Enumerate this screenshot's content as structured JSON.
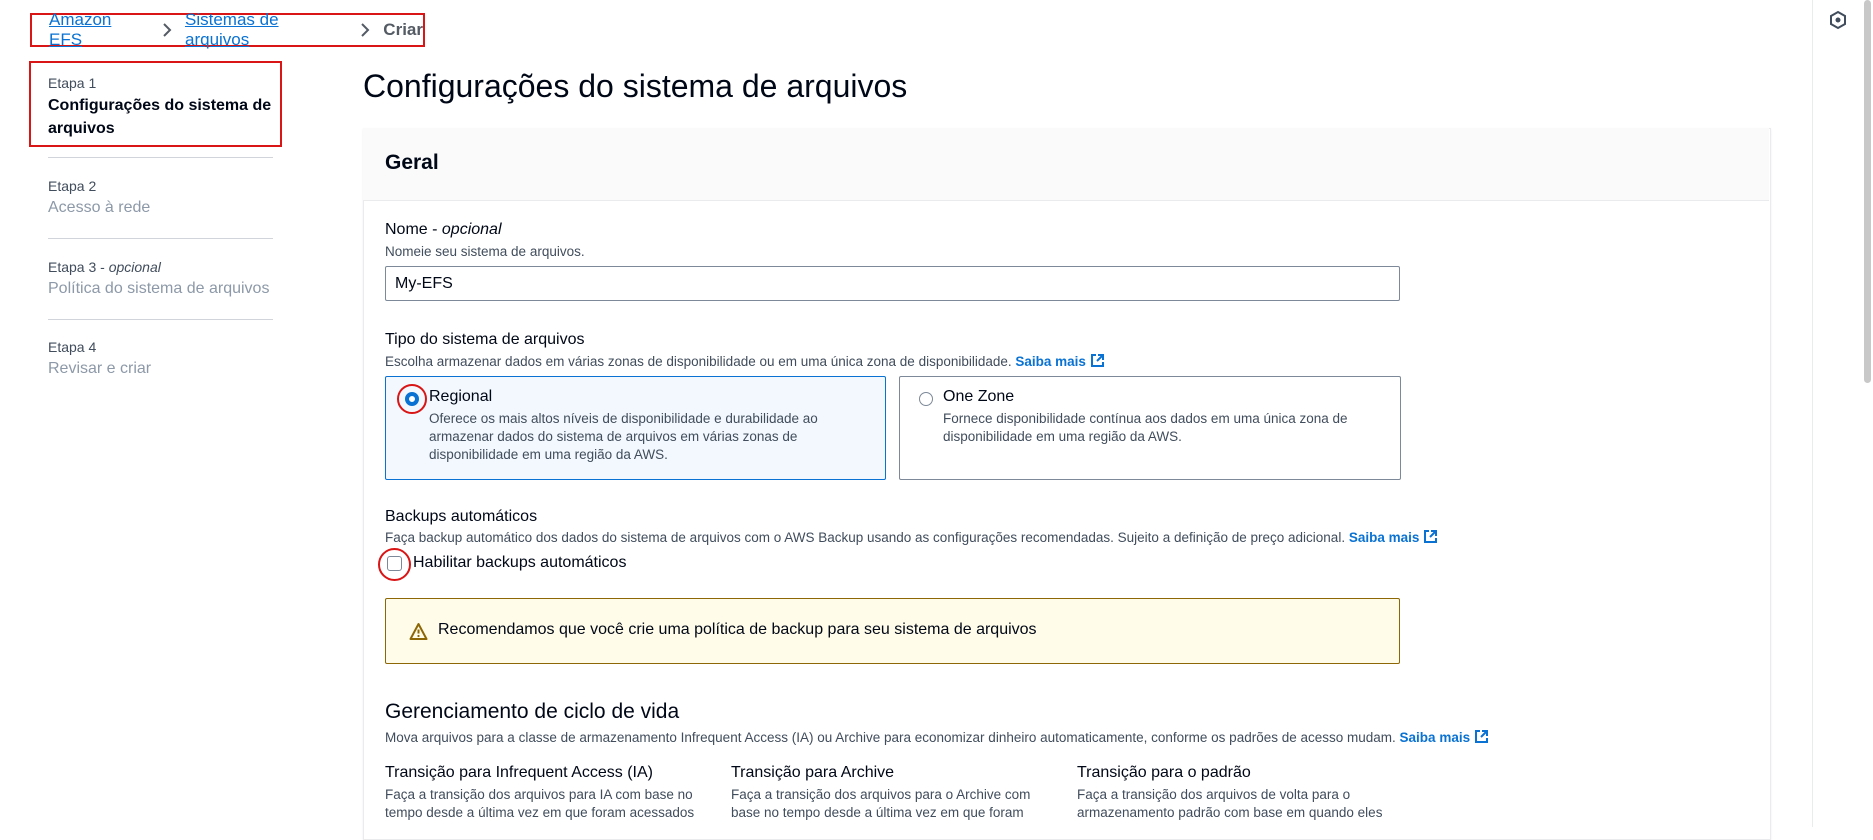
{
  "breadcrumb": {
    "items": [
      "Amazon EFS",
      "Sistemas de arquivos"
    ],
    "current": "Criar"
  },
  "steps": [
    {
      "label": "Etapa 1",
      "optional": "",
      "title": "Configurações do sistema de arquivos"
    },
    {
      "label": "Etapa 2",
      "optional": "",
      "title": "Acesso à rede"
    },
    {
      "label": "Etapa 3 - ",
      "optional": "opcional",
      "title": "Política do sistema de arquivos"
    },
    {
      "label": "Etapa 4",
      "optional": "",
      "title": "Revisar e criar"
    }
  ],
  "page": {
    "title": "Configurações do sistema de arquivos"
  },
  "general": {
    "title": "Geral",
    "name": {
      "label": "Nome - ",
      "optional": "opcional",
      "description": "Nomeie seu sistema de arquivos.",
      "value": "My-EFS"
    },
    "fs_type": {
      "label": "Tipo do sistema de arquivos",
      "description": "Escolha armazenar dados em várias zonas de disponibilidade ou em uma única zona de disponibilidade.",
      "learn_more": "Saiba mais",
      "options": [
        {
          "title": "Regional",
          "description": "Oferece os mais altos níveis de disponibilidade e durabilidade ao armazenar dados do sistema de arquivos em várias zonas de disponibilidade em uma região da AWS.",
          "selected": true
        },
        {
          "title": "One Zone",
          "description": "Fornece disponibilidade contínua aos dados em uma única zona de disponibilidade em uma região da AWS.",
          "selected": false
        }
      ]
    },
    "backups": {
      "label": "Backups automáticos",
      "description": "Faça backup automático dos dados do sistema de arquivos com o AWS Backup usando as configurações recomendadas. Sujeito a definição de preço adicional.",
      "learn_more": "Saiba mais",
      "checkbox_label": "Habilitar backups automáticos",
      "checked": false
    },
    "alert": {
      "text": "Recomendamos que você crie uma política de backup para seu sistema de arquivos"
    },
    "lifecycle": {
      "title": "Gerenciamento de ciclo de vida",
      "description": "Mova arquivos para a classe de armazenamento Infrequent Access (IA) ou Archive para economizar dinheiro automaticamente, conforme os padrões de acesso mudam.",
      "learn_more": "Saiba mais",
      "columns": [
        {
          "title": "Transição para Infrequent Access (IA)",
          "line1": "Faça a transição dos arquivos para IA com base no",
          "line2": "tempo desde a última vez em que foram acessados"
        },
        {
          "title": "Transição para Archive",
          "line1": "Faça a transição dos arquivos para o Archive com",
          "line2": "base no tempo desde a última vez em que foram"
        },
        {
          "title": "Transição para o padrão",
          "line1": "Faça a transição dos arquivos de volta para o",
          "line2": "armazenamento padrão com base em quando eles"
        }
      ]
    }
  },
  "colors": {
    "link": "#0972d3",
    "highlight_red": "#d91515",
    "warning_border": "#8d6605",
    "warning_bg": "#fffce9"
  }
}
